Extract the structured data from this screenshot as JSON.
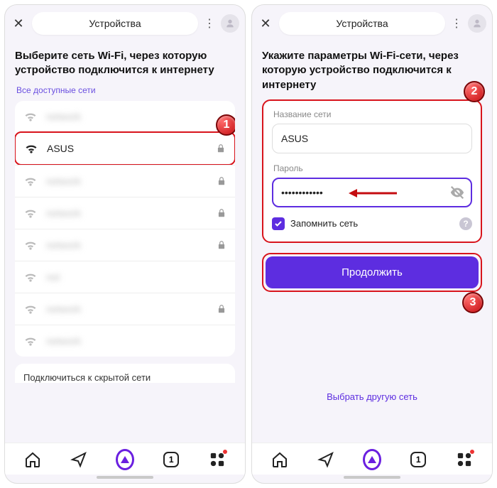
{
  "header": {
    "title": "Устройства"
  },
  "left": {
    "heading": "Выберите сеть Wi-Fi, через которую устройство подключится к интернету",
    "sub": "Все доступные сети",
    "networks": [
      {
        "name": "network",
        "locked": false,
        "blur": true
      },
      {
        "name": "ASUS",
        "locked": true,
        "blur": false,
        "highlighted": true
      },
      {
        "name": "network",
        "locked": true,
        "blur": true
      },
      {
        "name": "network",
        "locked": true,
        "blur": true
      },
      {
        "name": "network",
        "locked": true,
        "blur": true
      },
      {
        "name": "net",
        "locked": false,
        "blur": true
      },
      {
        "name": "network",
        "locked": true,
        "blur": true
      },
      {
        "name": "network",
        "locked": false,
        "blur": true
      }
    ],
    "hidden_link": "Подключиться к скрытой сети"
  },
  "right": {
    "heading": "Укажите параметры Wi-Fi-сети, через которую устройство подключится к интернету",
    "name_label": "Название сети",
    "name_value": "ASUS",
    "pw_label": "Пароль",
    "pw_value": "••••••••••••",
    "remember": "Запомнить сеть",
    "cta": "Продолжить",
    "alt": "Выбрать другую сеть"
  },
  "bottom": {
    "count": "1"
  },
  "badges": {
    "b1": "1",
    "b2": "2",
    "b3": "3"
  }
}
